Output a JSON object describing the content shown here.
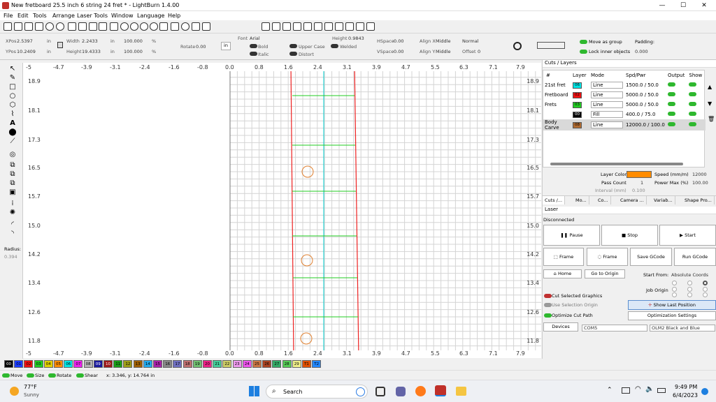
{
  "window": {
    "title": "New fretboard 25.5 inch 6 string 24 fret * - LightBurn 1.4.00"
  },
  "menu": [
    "File",
    "Edit",
    "Tools",
    "Arrange",
    "Laser Tools",
    "Window",
    "Language",
    "Help"
  ],
  "props": {
    "xpos_label": "XPos",
    "xpos": "2.5397",
    "ypos_label": "YPos",
    "ypos": "10.2409",
    "unit": "in",
    "width_label": "Width",
    "width": "2.2433",
    "height_label": "Height",
    "height": "19.4333",
    "scale_w": "100.000",
    "scale_h": "100.000",
    "pct": "%",
    "rotate_label": "Rotate",
    "rotate": "0.00",
    "in_btn": "in"
  },
  "text": {
    "font_label": "Font",
    "font": "Arial",
    "height_label": "Height",
    "height": "0.9843",
    "hspace_label": "HSpace",
    "hspace": "0.00",
    "vspace_label": "VSpace",
    "vspace": "0.00",
    "alignx_label": "Align X",
    "alignx": "Middle",
    "aligny_label": "Align Y",
    "aligny": "Middle",
    "mode": "Normal",
    "offset_label": "Offset",
    "offset": "0",
    "bold": "Bold",
    "italic": "Italic",
    "upper": "Upper Case",
    "distort": "Distort",
    "welded": "Welded"
  },
  "group": {
    "move_as_group": "Move as group",
    "lock_inner": "Lock inner objects",
    "padding_label": "Padding:",
    "padding": "0.000"
  },
  "ruler": {
    "top": [
      "-5",
      "-4.7",
      "-3.9",
      "-3.1",
      "-2.4",
      "-1.6",
      "-0.8",
      "0.0",
      "0.8",
      "1.6",
      "2.4",
      "3.1",
      "3.9",
      "4.7",
      "5.5",
      "6.3",
      "7.1",
      "7.9"
    ],
    "left": [
      "18.9",
      "18.1",
      "17.3",
      "16.5",
      "15.7",
      "15.0",
      "14.2",
      "13.4",
      "12.6",
      "11.8"
    ]
  },
  "radius": {
    "label": "Radius:",
    "value": "0.394"
  },
  "cuts": {
    "title": "Cuts / Layers",
    "headers": [
      "#",
      "Layer",
      "Mode",
      "Spd/Pwr",
      "Output",
      "Show"
    ],
    "rows": [
      {
        "name": "21st fret",
        "layer": "06",
        "color": "#00e5e5",
        "mode": "Line",
        "spd": "1500.0 / 50.0"
      },
      {
        "name": "Fretboard",
        "layer": "02",
        "color": "#ee1111",
        "mode": "Line",
        "spd": "5000.0 / 50.0"
      },
      {
        "name": "Frets",
        "layer": "03",
        "color": "#22cc22",
        "mode": "Line",
        "spd": "5000.0 / 50.0"
      },
      {
        "name": "",
        "layer": "00",
        "color": "#000000",
        "mode": "Fill",
        "spd": "400.0 / 75.0"
      },
      {
        "name": "Body Carve",
        "layer": "08",
        "color": "#b06a30",
        "mode": "Line",
        "spd": "12000.0 / 100.0"
      }
    ],
    "layer_color_label": "Layer Color",
    "layer_color": "#ff8c00",
    "speed_label": "Speed (mm/m)",
    "speed": "12000",
    "pass_label": "Pass Count",
    "pass": "1",
    "power_label": "Power Max (%)",
    "power": "100.00",
    "interval_label": "Interval (mm)",
    "interval": "0.100",
    "tabs": [
      "Cuts /...",
      "Mo...",
      "Co...",
      "Camera ...",
      "Variab...",
      "Shape Pro..."
    ]
  },
  "laser": {
    "title": "Laser",
    "status": "Disconnected",
    "pause": "Pause",
    "stop": "Stop",
    "start": "Start",
    "frame1": "Frame",
    "frame2": "Frame",
    "save_gcode": "Save GCode",
    "run_gcode": "Run GCode",
    "home": "Home",
    "go_origin": "Go to Origin",
    "start_from_label": "Start From:",
    "start_from": "Absolute Coords",
    "job_origin": "Job Origin",
    "cut_selected": "Cut Selected Graphics",
    "use_selection": "Use Selection Origin",
    "show_last": "Show Last Position",
    "optimize_cut": "Optimize Cut Path",
    "optimization": "Optimization Settings",
    "devices": "Devices",
    "port": "COM5",
    "device": "OLM2 Black and Blue"
  },
  "palette": [
    {
      "l": "00",
      "c": "#000000"
    },
    {
      "l": "01",
      "c": "#1a3cff"
    },
    {
      "l": "02",
      "c": "#ee1111"
    },
    {
      "l": "03",
      "c": "#22cc22"
    },
    {
      "l": "04",
      "c": "#e0d000"
    },
    {
      "l": "05",
      "c": "#ff8c00"
    },
    {
      "l": "06",
      "c": "#00e5e5"
    },
    {
      "l": "07",
      "c": "#ee22ee"
    },
    {
      "l": "08",
      "c": "#b4b4b4"
    },
    {
      "l": "09",
      "c": "#1a1a9e"
    },
    {
      "l": "10",
      "c": "#9e1a1a"
    },
    {
      "l": "11",
      "c": "#1a9e1a"
    },
    {
      "l": "12",
      "c": "#9e9e1a"
    },
    {
      "l": "13",
      "c": "#a06000"
    },
    {
      "l": "14",
      "c": "#22aaee"
    },
    {
      "l": "15",
      "c": "#aa22aa"
    },
    {
      "l": "16",
      "c": "#888888"
    },
    {
      "l": "17",
      "c": "#7070c0"
    },
    {
      "l": "18",
      "c": "#c07070"
    },
    {
      "l": "19",
      "c": "#70c070"
    },
    {
      "l": "20",
      "c": "#ee2288"
    },
    {
      "l": "21",
      "c": "#44cc99"
    },
    {
      "l": "22",
      "c": "#cccc66"
    },
    {
      "l": "23",
      "c": "#ee99ee"
    },
    {
      "l": "24",
      "c": "#ee55ee"
    },
    {
      "l": "25",
      "c": "#cc7744"
    },
    {
      "l": "26",
      "c": "#aa4422"
    },
    {
      "l": "27",
      "c": "#33aa66"
    },
    {
      "l": "28",
      "c": "#55cc55"
    },
    {
      "l": "29",
      "c": "#eeee88"
    },
    {
      "l": "T1",
      "c": "#e05000"
    },
    {
      "l": "T2",
      "c": "#2288ff"
    }
  ],
  "status": {
    "move": "Move",
    "size": "Size",
    "rotate": "Rotate",
    "shear": "Shear",
    "coords": "x: 3.346, y: 14.764 in"
  },
  "taskbar": {
    "temp": "77°F",
    "weather": "Sunny",
    "search": "Search",
    "time": "9:49 PM",
    "date": "6/4/2023"
  }
}
